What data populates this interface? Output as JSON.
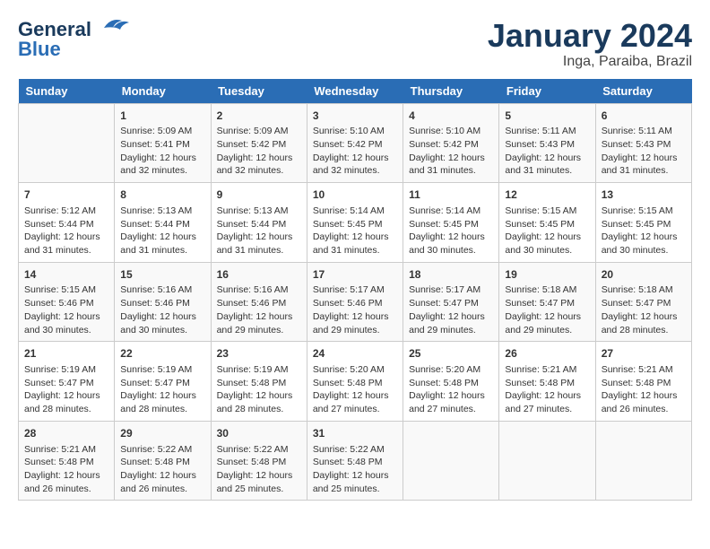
{
  "logo": {
    "line1": "General",
    "line2": "Blue"
  },
  "title": "January 2024",
  "subtitle": "Inga, Paraiba, Brazil",
  "days_header": [
    "Sunday",
    "Monday",
    "Tuesday",
    "Wednesday",
    "Thursday",
    "Friday",
    "Saturday"
  ],
  "weeks": [
    [
      {
        "day": "",
        "info": ""
      },
      {
        "day": "1",
        "info": "Sunrise: 5:09 AM\nSunset: 5:41 PM\nDaylight: 12 hours\nand 32 minutes."
      },
      {
        "day": "2",
        "info": "Sunrise: 5:09 AM\nSunset: 5:42 PM\nDaylight: 12 hours\nand 32 minutes."
      },
      {
        "day": "3",
        "info": "Sunrise: 5:10 AM\nSunset: 5:42 PM\nDaylight: 12 hours\nand 32 minutes."
      },
      {
        "day": "4",
        "info": "Sunrise: 5:10 AM\nSunset: 5:42 PM\nDaylight: 12 hours\nand 31 minutes."
      },
      {
        "day": "5",
        "info": "Sunrise: 5:11 AM\nSunset: 5:43 PM\nDaylight: 12 hours\nand 31 minutes."
      },
      {
        "day": "6",
        "info": "Sunrise: 5:11 AM\nSunset: 5:43 PM\nDaylight: 12 hours\nand 31 minutes."
      }
    ],
    [
      {
        "day": "7",
        "info": "Sunrise: 5:12 AM\nSunset: 5:44 PM\nDaylight: 12 hours\nand 31 minutes."
      },
      {
        "day": "8",
        "info": "Sunrise: 5:13 AM\nSunset: 5:44 PM\nDaylight: 12 hours\nand 31 minutes."
      },
      {
        "day": "9",
        "info": "Sunrise: 5:13 AM\nSunset: 5:44 PM\nDaylight: 12 hours\nand 31 minutes."
      },
      {
        "day": "10",
        "info": "Sunrise: 5:14 AM\nSunset: 5:45 PM\nDaylight: 12 hours\nand 31 minutes."
      },
      {
        "day": "11",
        "info": "Sunrise: 5:14 AM\nSunset: 5:45 PM\nDaylight: 12 hours\nand 30 minutes."
      },
      {
        "day": "12",
        "info": "Sunrise: 5:15 AM\nSunset: 5:45 PM\nDaylight: 12 hours\nand 30 minutes."
      },
      {
        "day": "13",
        "info": "Sunrise: 5:15 AM\nSunset: 5:45 PM\nDaylight: 12 hours\nand 30 minutes."
      }
    ],
    [
      {
        "day": "14",
        "info": "Sunrise: 5:15 AM\nSunset: 5:46 PM\nDaylight: 12 hours\nand 30 minutes."
      },
      {
        "day": "15",
        "info": "Sunrise: 5:16 AM\nSunset: 5:46 PM\nDaylight: 12 hours\nand 30 minutes."
      },
      {
        "day": "16",
        "info": "Sunrise: 5:16 AM\nSunset: 5:46 PM\nDaylight: 12 hours\nand 29 minutes."
      },
      {
        "day": "17",
        "info": "Sunrise: 5:17 AM\nSunset: 5:46 PM\nDaylight: 12 hours\nand 29 minutes."
      },
      {
        "day": "18",
        "info": "Sunrise: 5:17 AM\nSunset: 5:47 PM\nDaylight: 12 hours\nand 29 minutes."
      },
      {
        "day": "19",
        "info": "Sunrise: 5:18 AM\nSunset: 5:47 PM\nDaylight: 12 hours\nand 29 minutes."
      },
      {
        "day": "20",
        "info": "Sunrise: 5:18 AM\nSunset: 5:47 PM\nDaylight: 12 hours\nand 28 minutes."
      }
    ],
    [
      {
        "day": "21",
        "info": "Sunrise: 5:19 AM\nSunset: 5:47 PM\nDaylight: 12 hours\nand 28 minutes."
      },
      {
        "day": "22",
        "info": "Sunrise: 5:19 AM\nSunset: 5:47 PM\nDaylight: 12 hours\nand 28 minutes."
      },
      {
        "day": "23",
        "info": "Sunrise: 5:19 AM\nSunset: 5:48 PM\nDaylight: 12 hours\nand 28 minutes."
      },
      {
        "day": "24",
        "info": "Sunrise: 5:20 AM\nSunset: 5:48 PM\nDaylight: 12 hours\nand 27 minutes."
      },
      {
        "day": "25",
        "info": "Sunrise: 5:20 AM\nSunset: 5:48 PM\nDaylight: 12 hours\nand 27 minutes."
      },
      {
        "day": "26",
        "info": "Sunrise: 5:21 AM\nSunset: 5:48 PM\nDaylight: 12 hours\nand 27 minutes."
      },
      {
        "day": "27",
        "info": "Sunrise: 5:21 AM\nSunset: 5:48 PM\nDaylight: 12 hours\nand 26 minutes."
      }
    ],
    [
      {
        "day": "28",
        "info": "Sunrise: 5:21 AM\nSunset: 5:48 PM\nDaylight: 12 hours\nand 26 minutes."
      },
      {
        "day": "29",
        "info": "Sunrise: 5:22 AM\nSunset: 5:48 PM\nDaylight: 12 hours\nand 26 minutes."
      },
      {
        "day": "30",
        "info": "Sunrise: 5:22 AM\nSunset: 5:48 PM\nDaylight: 12 hours\nand 25 minutes."
      },
      {
        "day": "31",
        "info": "Sunrise: 5:22 AM\nSunset: 5:48 PM\nDaylight: 12 hours\nand 25 minutes."
      },
      {
        "day": "",
        "info": ""
      },
      {
        "day": "",
        "info": ""
      },
      {
        "day": "",
        "info": ""
      }
    ]
  ]
}
